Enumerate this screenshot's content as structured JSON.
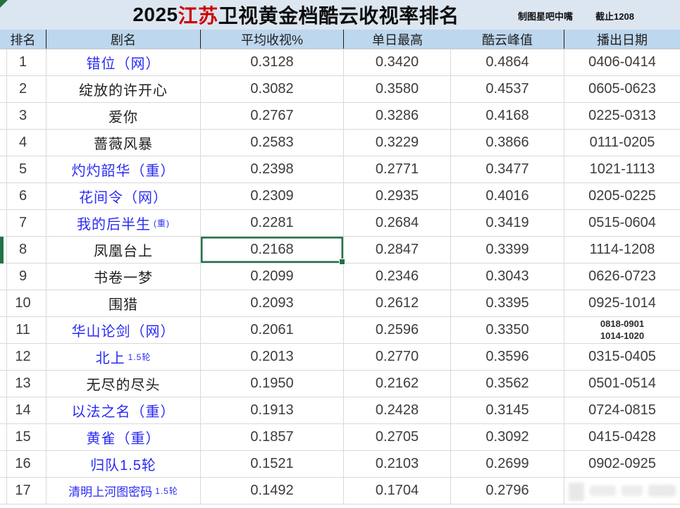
{
  "title": {
    "part_year": "2025",
    "part_highlight": "江苏",
    "part_rest": "卫视黄金档酷云收视率排名",
    "credit": "制图星吧中嘴",
    "cutoff": "截止1208"
  },
  "colors": {
    "highlight_red": "#cc0000",
    "link_blue": "#2b2bf5",
    "header_bg": "#bdd7ee",
    "title_bg": "#dce6f1",
    "selection_green": "#217346"
  },
  "table": {
    "headers": [
      "排名",
      "剧名",
      "平均收视%",
      "单日最高",
      "酷云峰值",
      "播出日期"
    ],
    "rows": [
      {
        "rank": "1",
        "name": "错位（网）",
        "suffix": "",
        "blue": true,
        "small_name": false,
        "avg": "0.3128",
        "day_max": "0.3420",
        "peak": "0.4864",
        "dates": [
          "0406-0414"
        ],
        "selected": false,
        "watermark": false
      },
      {
        "rank": "2",
        "name": "绽放的许开心",
        "suffix": "",
        "blue": false,
        "small_name": false,
        "avg": "0.3082",
        "day_max": "0.3580",
        "peak": "0.4537",
        "dates": [
          "0605-0623"
        ],
        "selected": false,
        "watermark": false
      },
      {
        "rank": "3",
        "name": "爱你",
        "suffix": "",
        "blue": false,
        "small_name": false,
        "avg": "0.2767",
        "day_max": "0.3286",
        "peak": "0.4168",
        "dates": [
          "0225-0313"
        ],
        "selected": false,
        "watermark": false
      },
      {
        "rank": "4",
        "name": "蔷薇风暴",
        "suffix": "",
        "blue": false,
        "small_name": false,
        "avg": "0.2583",
        "day_max": "0.3229",
        "peak": "0.3866",
        "dates": [
          "0111-0205"
        ],
        "selected": false,
        "watermark": false
      },
      {
        "rank": "5",
        "name": "灼灼韶华（重）",
        "suffix": "",
        "blue": true,
        "small_name": false,
        "avg": "0.2398",
        "day_max": "0.2771",
        "peak": "0.3477",
        "dates": [
          "1021-1113"
        ],
        "selected": false,
        "watermark": false
      },
      {
        "rank": "6",
        "name": "花间令（网）",
        "suffix": "",
        "blue": true,
        "small_name": false,
        "avg": "0.2309",
        "day_max": "0.2935",
        "peak": "0.4016",
        "dates": [
          "0205-0225"
        ],
        "selected": false,
        "watermark": false
      },
      {
        "rank": "7",
        "name": "我的后半生",
        "suffix": "(重)",
        "blue": true,
        "small_name": false,
        "avg": "0.2281",
        "day_max": "0.2684",
        "peak": "0.3419",
        "dates": [
          "0515-0604"
        ],
        "selected": false,
        "watermark": false
      },
      {
        "rank": "8",
        "name": "凤凰台上",
        "suffix": "",
        "blue": false,
        "small_name": false,
        "avg": "0.2168",
        "day_max": "0.2847",
        "peak": "0.3399",
        "dates": [
          "1114-1208"
        ],
        "selected": true,
        "watermark": false
      },
      {
        "rank": "9",
        "name": "书卷一梦",
        "suffix": "",
        "blue": false,
        "small_name": false,
        "avg": "0.2099",
        "day_max": "0.2346",
        "peak": "0.3043",
        "dates": [
          "0626-0723"
        ],
        "selected": false,
        "watermark": false
      },
      {
        "rank": "10",
        "name": "围猎",
        "suffix": "",
        "blue": false,
        "small_name": false,
        "avg": "0.2093",
        "day_max": "0.2612",
        "peak": "0.3395",
        "dates": [
          "0925-1014"
        ],
        "selected": false,
        "watermark": false
      },
      {
        "rank": "11",
        "name": "华山论剑（网）",
        "suffix": "",
        "blue": true,
        "small_name": false,
        "avg": "0.2061",
        "day_max": "0.2596",
        "peak": "0.3350",
        "dates": [
          "0818-0901",
          "1014-1020"
        ],
        "selected": false,
        "watermark": false
      },
      {
        "rank": "12",
        "name": "北上",
        "suffix": "1.5轮",
        "blue": true,
        "small_name": false,
        "avg": "0.2013",
        "day_max": "0.2770",
        "peak": "0.3596",
        "dates": [
          "0315-0405"
        ],
        "selected": false,
        "watermark": false
      },
      {
        "rank": "13",
        "name": "无尽的尽头",
        "suffix": "",
        "blue": false,
        "small_name": false,
        "avg": "0.1950",
        "day_max": "0.2162",
        "peak": "0.3562",
        "dates": [
          "0501-0514"
        ],
        "selected": false,
        "watermark": false
      },
      {
        "rank": "14",
        "name": "以法之名（重）",
        "suffix": "",
        "blue": true,
        "small_name": false,
        "avg": "0.1913",
        "day_max": "0.2428",
        "peak": "0.3145",
        "dates": [
          "0724-0815"
        ],
        "selected": false,
        "watermark": false
      },
      {
        "rank": "15",
        "name": "黄雀（重）",
        "suffix": "",
        "blue": true,
        "small_name": false,
        "avg": "0.1857",
        "day_max": "0.2705",
        "peak": "0.3092",
        "dates": [
          "0415-0428"
        ],
        "selected": false,
        "watermark": false
      },
      {
        "rank": "16",
        "name": "归队1.5轮",
        "suffix": "",
        "blue": true,
        "small_name": false,
        "avg": "0.1521",
        "day_max": "0.2103",
        "peak": "0.2699",
        "dates": [
          "0902-0925"
        ],
        "selected": false,
        "watermark": false
      },
      {
        "rank": "17",
        "name": "清明上河图密码",
        "suffix": "1.5轮",
        "blue": true,
        "small_name": true,
        "avg": "0.1492",
        "day_max": "0.1704",
        "peak": "0.2796",
        "dates": [],
        "selected": false,
        "watermark": true
      }
    ]
  }
}
